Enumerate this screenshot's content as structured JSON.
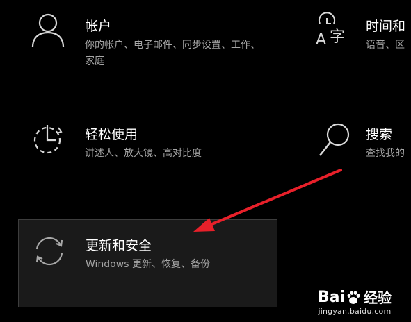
{
  "tiles": {
    "accounts": {
      "icon": "person-icon",
      "title": "帐户",
      "description": "你的帐户、电子邮件、同步设置、工作、家庭"
    },
    "time_language": {
      "icon": "time-language-icon",
      "title": "时间和",
      "description": "语音、区"
    },
    "ease_of_access": {
      "icon": "ease-of-access-icon",
      "title": "轻松使用",
      "description": "讲述人、放大镜、高对比度"
    },
    "search": {
      "icon": "search-icon",
      "title": "搜索",
      "description": "查找我的"
    },
    "update_security": {
      "icon": "sync-icon",
      "title": "更新和安全",
      "description": "Windows 更新、恢复、备份"
    }
  },
  "annotation": {
    "arrow_color": "#e8202a"
  },
  "watermark": {
    "brand_prefix": "Bai",
    "brand_suffix": "经验",
    "url": "jingyan.baidu.com"
  },
  "colors": {
    "background": "#000000",
    "title_text": "#ffffff",
    "description_text": "#a6a6a6",
    "hover_tile": "#1a1a1a"
  }
}
